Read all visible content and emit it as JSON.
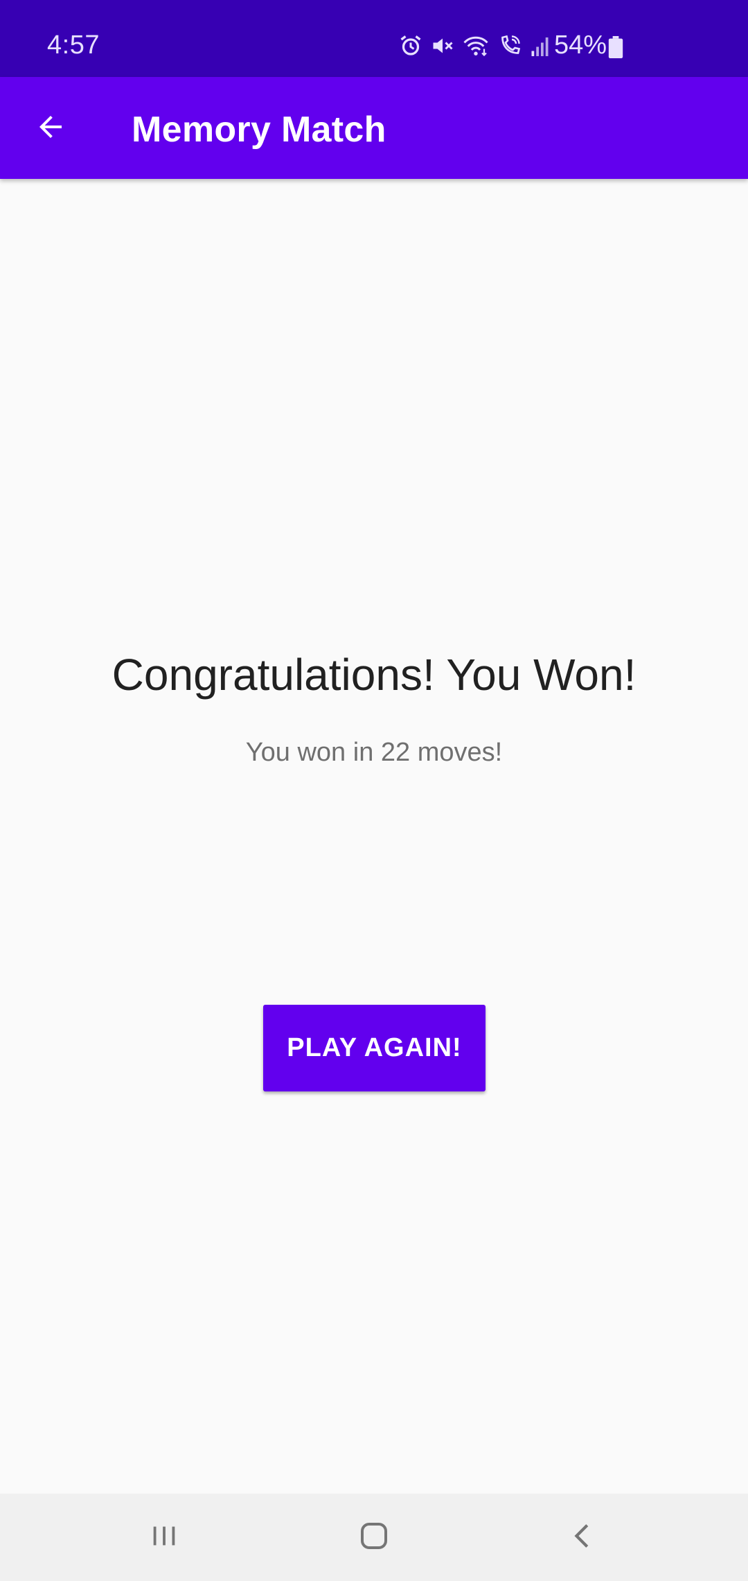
{
  "status_bar": {
    "time": "4:57",
    "battery": "54%",
    "icons": [
      "alarm-icon",
      "mute-icon",
      "wifi-icon",
      "wifi-calling-icon",
      "signal-icon",
      "battery-icon"
    ]
  },
  "app_bar": {
    "title": "Memory Match",
    "back_icon": "arrow-back-icon"
  },
  "main": {
    "headline": "Congratulations! You Won!",
    "subline": "You won in 22 moves!",
    "play_again_label": "PLAY AGAIN!"
  },
  "nav_bar": {
    "icons": [
      "recents-icon",
      "home-icon",
      "back-icon"
    ]
  },
  "colors": {
    "status_bar": "#3700b3",
    "primary": "#6200ee",
    "background": "#fafafa",
    "nav_bar": "#f0f0f0"
  }
}
